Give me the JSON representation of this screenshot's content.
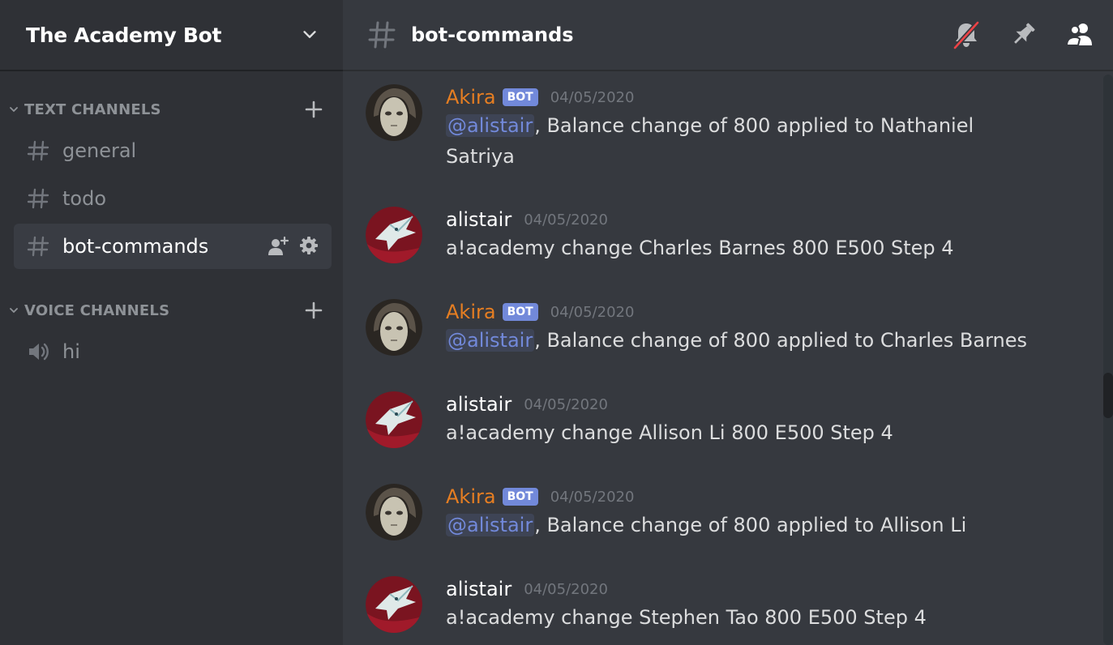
{
  "guild": {
    "name": "The Academy Bot"
  },
  "sidebar": {
    "categories": [
      {
        "label": "TEXT CHANNELS"
      },
      {
        "label": "VOICE CHANNELS"
      }
    ],
    "text_channels": [
      {
        "label": "general"
      },
      {
        "label": "todo"
      },
      {
        "label": "bot-commands",
        "active": true
      }
    ],
    "voice_channels": [
      {
        "label": "hi"
      }
    ]
  },
  "header": {
    "channel_name": "bot-commands",
    "icons": [
      "bell-muted-icon",
      "pin-icon",
      "members-icon"
    ]
  },
  "messages": [
    {
      "author": "Akira",
      "bot_badge": "BOT",
      "time": "04/05/2020",
      "mention": "@alistair",
      "text": ", Balance change of 800 applied to Nathaniel",
      "text2": "Satriya"
    },
    {
      "author": "alistair",
      "time": "04/05/2020",
      "text": "a!academy change Charles Barnes 800 E500 Step 4"
    },
    {
      "author": "Akira",
      "bot_badge": "BOT",
      "time": "04/05/2020",
      "mention": "@alistair",
      "text": ", Balance change of 800 applied to Charles Barnes"
    },
    {
      "author": "alistair",
      "time": "04/05/2020",
      "text": "a!academy change Allison Li 800 E500 Step 4"
    },
    {
      "author": "Akira",
      "bot_badge": "BOT",
      "time": "04/05/2020",
      "mention": "@alistair",
      "text": ", Balance change of 800 applied to Allison Li"
    },
    {
      "author": "alistair",
      "time": "04/05/2020",
      "text": "a!academy change Stephen Tao 800 E500 Step 4"
    }
  ],
  "colors": {
    "sidebar_bg": "#2f3136",
    "main_bg": "#36393f",
    "bot_name": "#e67e22",
    "bot_badge": "#7289da",
    "mention": "#7289da"
  }
}
